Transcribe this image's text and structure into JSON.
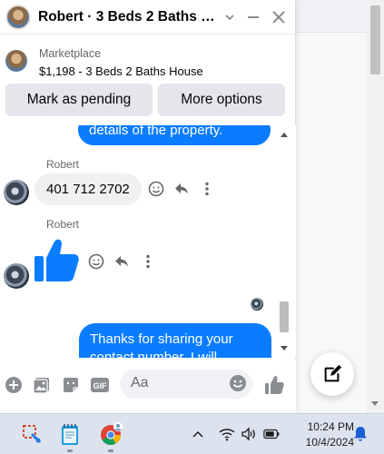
{
  "header": {
    "title": "Robert · 3 Beds 2 Baths Ho..."
  },
  "listing": {
    "label": "Marketplace",
    "title": "$1,198 - 3 Beds 2 Baths House"
  },
  "actions": {
    "mark_pending": "Mark as pending",
    "more_options": "More options"
  },
  "messages": {
    "out_partial": "details of the property.",
    "sender_1": "Robert",
    "phone": "401 712 2702",
    "sender_2": "Robert",
    "out_last_line1": "Thanks for sharing your",
    "out_last_line2": "contact number, I will"
  },
  "composer": {
    "placeholder": "Aa"
  },
  "taskbar": {
    "time": "10:24 PM",
    "date": "10/4/2024"
  },
  "colors": {
    "messenger_blue": "#0a7cff",
    "like_blue": "#0a7cff",
    "icon_gray": "#8a8d91"
  }
}
